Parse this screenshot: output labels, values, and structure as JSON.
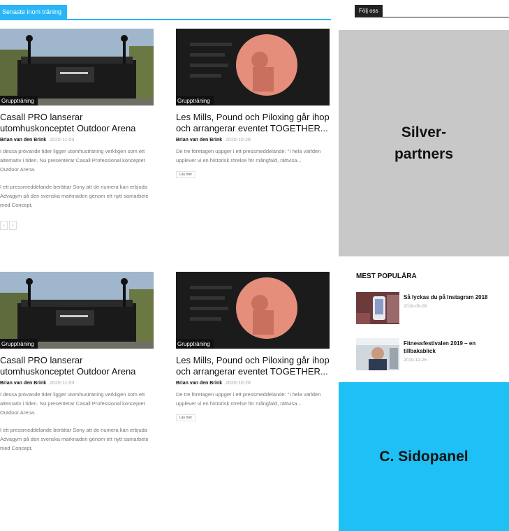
{
  "section": {
    "title": "Senaste inom träning"
  },
  "articles": [
    {
      "category": "Gruppträning",
      "title": "Casall PRO lanserar utomhuskonceptet Outdoor Arena",
      "author": "Brian van den Brink",
      "date": "2020-11-03",
      "excerpt1": "I dessa prövande tider ligger utomhusträning verkligen som ett alternativ i tiden. Nu presenterar Casall Professional konceptet Outdoor Arena.",
      "excerpt2": "I ett pressmeddelande berättar Sony att de numera kan erbjuda Advagym på den svenska marknaden genom ett nytt samarbete med Concept."
    },
    {
      "category": "Gruppträning",
      "title": "Les Mills, Pound och Piloxing går ihop och arrangerar eventet TOGETHER...",
      "author": "Brian van den Brink",
      "date": "2020-10-28",
      "excerpt1": "De tre företagen uppger i ett pressmeddelande: \"I hela världen upplever vi en historisk rörelse för mångfald, rättvisa...",
      "readmore": "Läs mer"
    }
  ],
  "pager": {
    "prev": "‹",
    "next": "›"
  },
  "sidebar": {
    "follow": "Följ oss",
    "silver_line1": "Silver-",
    "silver_line2": "partners",
    "popular_title": "MEST POPULÄRA",
    "popular": [
      {
        "title": "Så lyckas du på Instagram 2018",
        "date": "2018-06-08"
      },
      {
        "title": "Fitnessfestivalen 2019 – en tillbakablick",
        "date": "2019-12-26"
      }
    ],
    "sidopanel": "C. Sidopanel"
  },
  "colors": {
    "accent": "#29b6f6",
    "silver_bg": "#c8c8c8",
    "sidopanel_bg": "#1ec0f5"
  }
}
